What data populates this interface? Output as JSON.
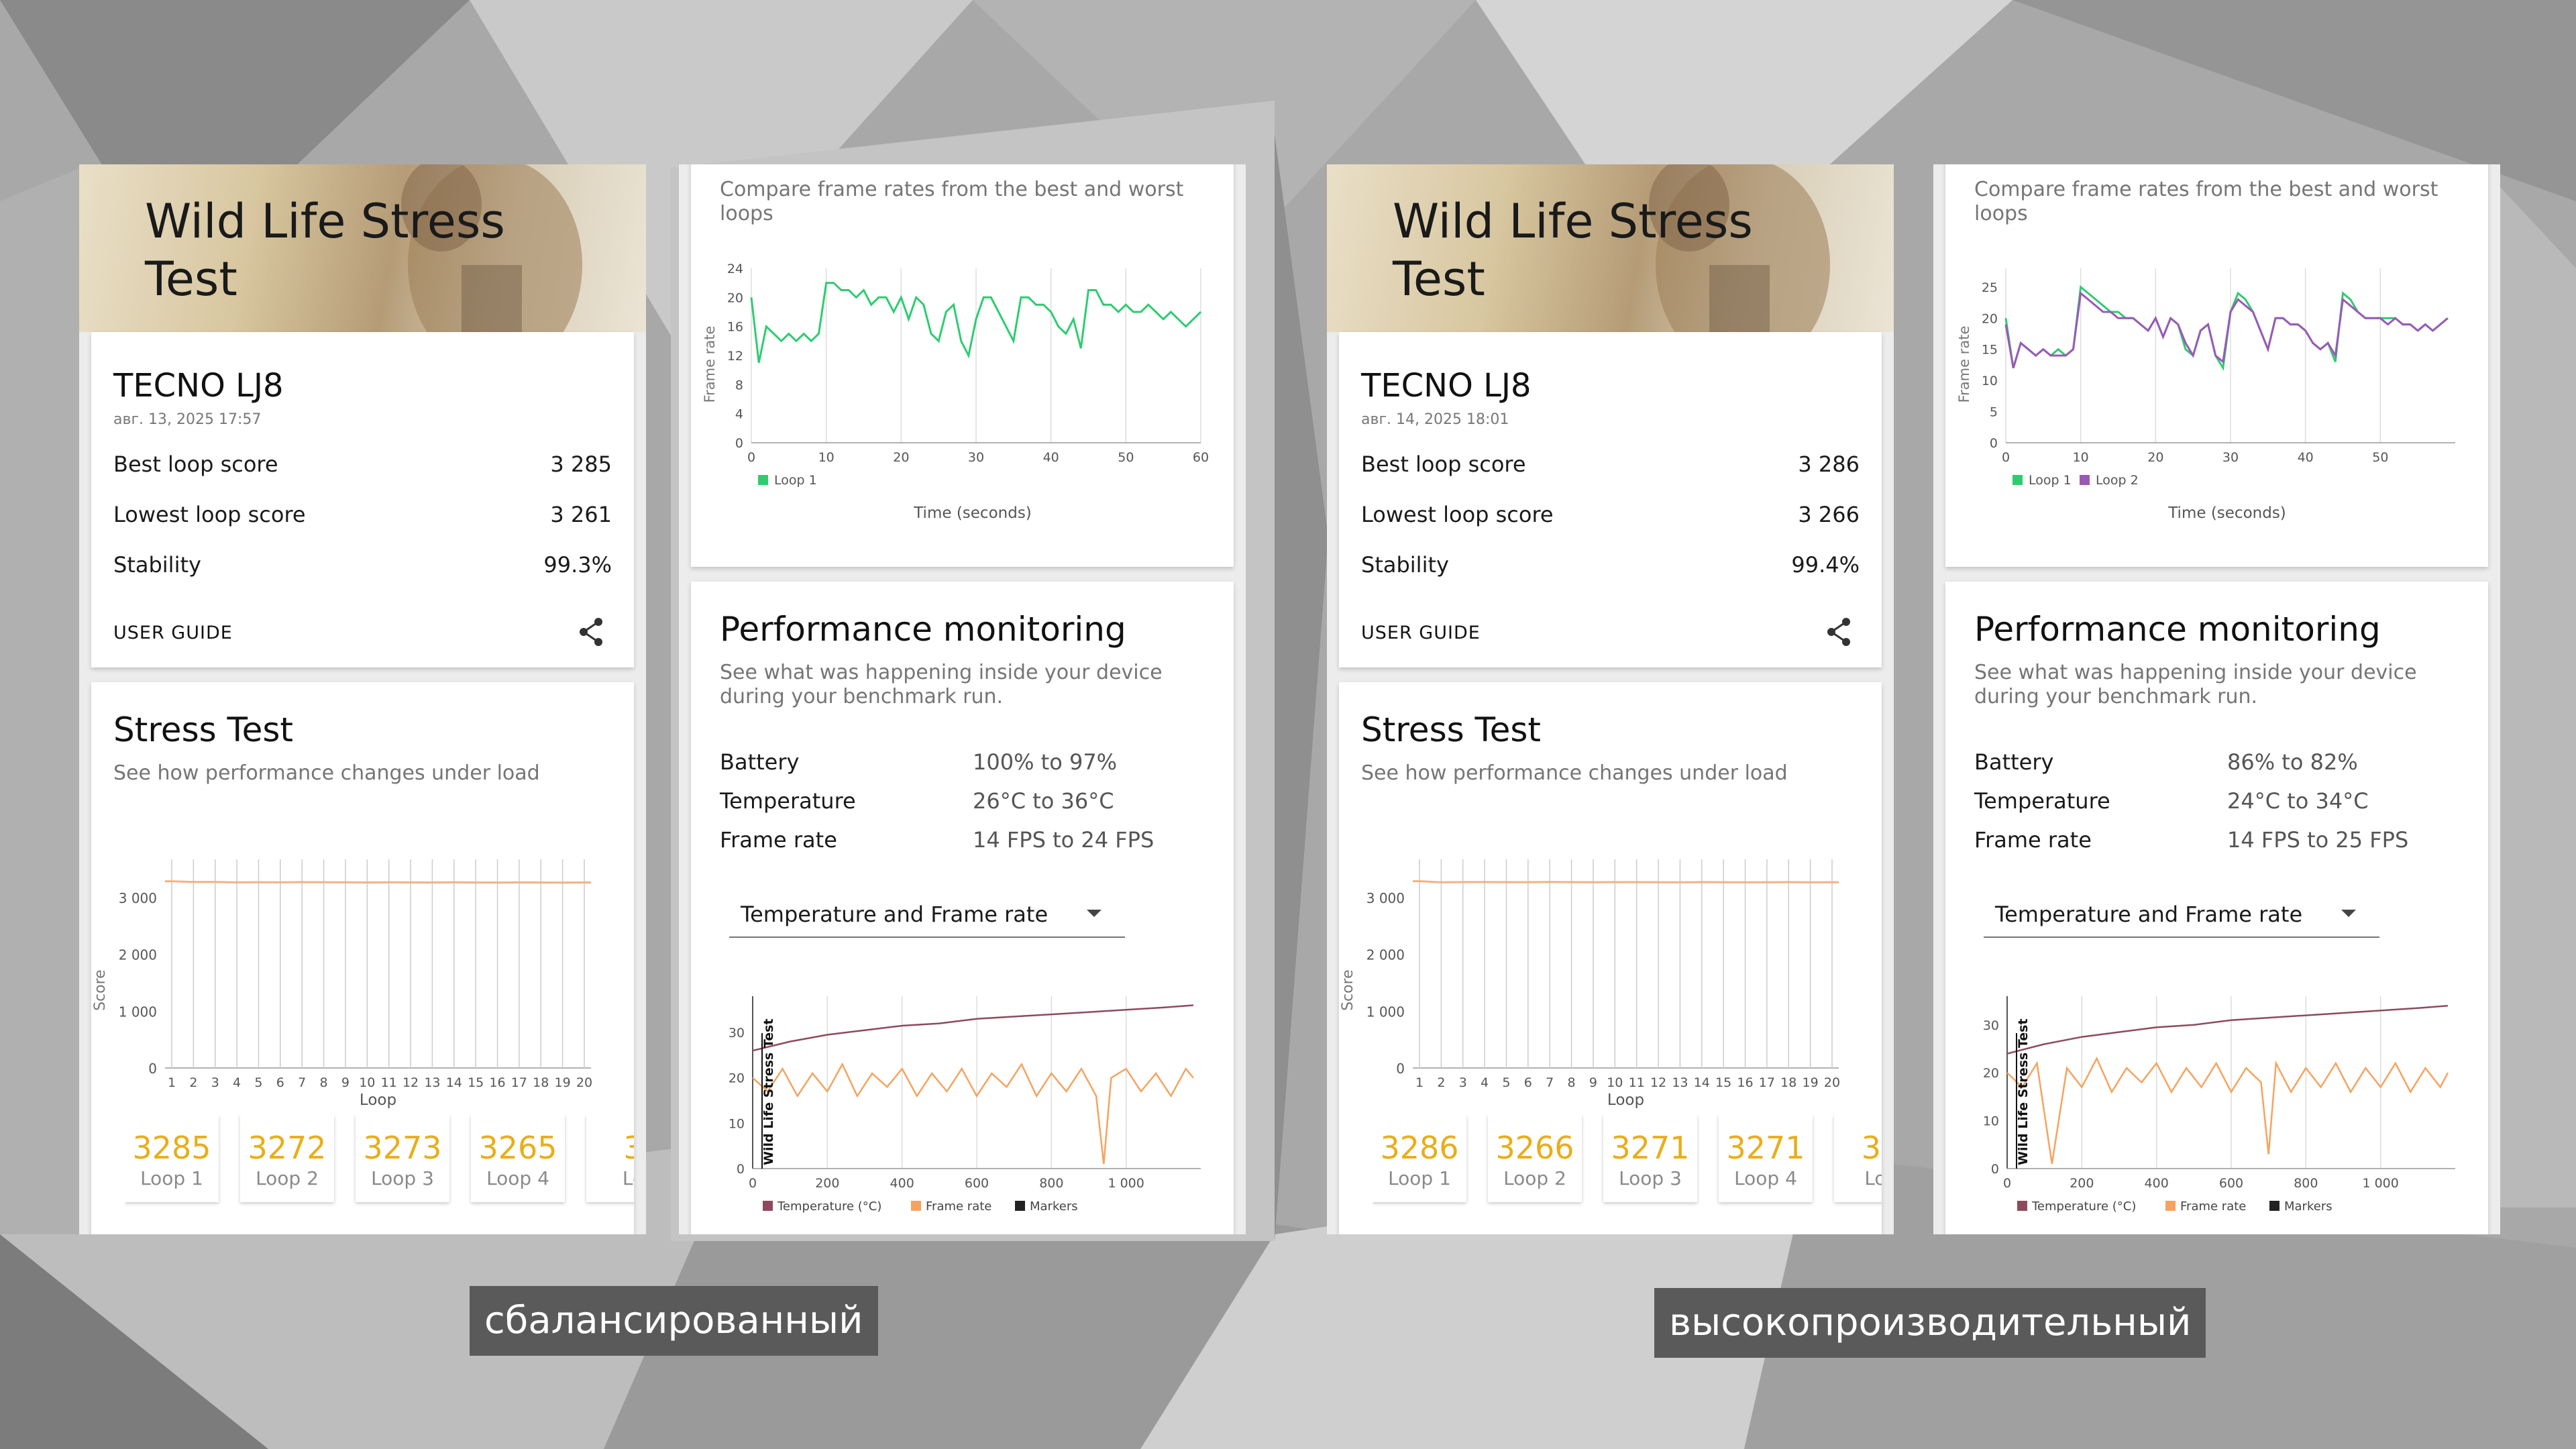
{
  "panels": [
    {
      "title_line1": "Wild Life Stress",
      "title_line2": "Test",
      "device": "TECNO LJ8",
      "date": "авг. 13, 2025 17:57",
      "best_label": "Best loop score",
      "best_value": "3 285",
      "lowest_label": "Lowest loop score",
      "lowest_value": "3 261",
      "stability_label": "Stability",
      "stability_value": "99.3%",
      "user_guide": "USER GUIDE",
      "stress_title": "Stress Test",
      "stress_sub": "See how performance changes under load",
      "loops": [
        {
          "score": "3285",
          "name": "Loop 1"
        },
        {
          "score": "3272",
          "name": "Loop 2"
        },
        {
          "score": "3273",
          "name": "Loop 3"
        },
        {
          "score": "3265",
          "name": "Loop 4"
        },
        {
          "score": "3",
          "name": "Lo"
        }
      ],
      "compare_sub": "Compare frame rates from the best and worst loops",
      "perf_title": "Performance monitoring",
      "perf_sub": "See what was happening inside your device during your benchmark run.",
      "battery_label": "Battery",
      "battery_value": "100% to 97%",
      "temp_label": "Temperature",
      "temp_value": "26°C to 36°C",
      "fps_label": "Frame rate",
      "fps_value": "14 FPS to 24 FPS",
      "dropdown": "Temperature and Frame rate"
    },
    {
      "title_line1": "Wild Life Stress",
      "title_line2": "Test",
      "device": "TECNO LJ8",
      "date": "авг. 14, 2025 18:01",
      "best_label": "Best loop score",
      "best_value": "3 286",
      "lowest_label": "Lowest loop score",
      "lowest_value": "3 266",
      "stability_label": "Stability",
      "stability_value": "99.4%",
      "user_guide": "USER GUIDE",
      "stress_title": "Stress Test",
      "stress_sub": "See how performance changes under load",
      "loops": [
        {
          "score": "3286",
          "name": "Loop 1"
        },
        {
          "score": "3266",
          "name": "Loop 2"
        },
        {
          "score": "3271",
          "name": "Loop 3"
        },
        {
          "score": "3271",
          "name": "Loop 4"
        },
        {
          "score": "32",
          "name": "Loo"
        }
      ],
      "compare_sub": "Compare frame rates from the best and worst loops",
      "perf_title": "Performance monitoring",
      "perf_sub": "See what was happening inside your device during your benchmark run.",
      "battery_label": "Battery",
      "battery_value": "86% to 82%",
      "temp_label": "Temperature",
      "temp_value": "24°C to 34°C",
      "fps_label": "Frame rate",
      "fps_value": "14 FPS to 25 FPS",
      "dropdown": "Temperature and Frame rate"
    }
  ],
  "captions": {
    "left": "сбалансированный",
    "right": "высокопроизводительный"
  },
  "chart_data": [
    {
      "id": "stress-left",
      "type": "bar",
      "ylabel": "Score",
      "xlabel": "Loop",
      "ylim": [
        0,
        3600
      ],
      "yticks": [
        "0",
        "1 000",
        "2 000",
        "3 000"
      ],
      "ytick_values": [
        0,
        1000,
        2000,
        3000
      ],
      "categories": [
        "1",
        "2",
        "3",
        "4",
        "5",
        "6",
        "7",
        "8",
        "9",
        "10",
        "11",
        "12",
        "13",
        "14",
        "15",
        "16",
        "17",
        "18",
        "19",
        "20"
      ],
      "values": [
        3285,
        3272,
        3273,
        3265,
        3268,
        3266,
        3270,
        3268,
        3266,
        3264,
        3267,
        3265,
        3263,
        3266,
        3264,
        3262,
        3265,
        3263,
        3261,
        3264
      ],
      "color": "#f4b183"
    },
    {
      "id": "stress-right",
      "type": "bar",
      "ylabel": "Score",
      "xlabel": "Loop",
      "ylim": [
        0,
        3600
      ],
      "yticks": [
        "0",
        "1 000",
        "2 000",
        "3 000"
      ],
      "ytick_values": [
        0,
        1000,
        2000,
        3000
      ],
      "categories": [
        "1",
        "2",
        "3",
        "4",
        "5",
        "6",
        "7",
        "8",
        "9",
        "10",
        "11",
        "12",
        "13",
        "14",
        "15",
        "16",
        "17",
        "18",
        "19",
        "20"
      ],
      "values": [
        3286,
        3266,
        3271,
        3271,
        3270,
        3268,
        3272,
        3270,
        3268,
        3269,
        3270,
        3268,
        3267,
        3269,
        3268,
        3267,
        3268,
        3270,
        3266,
        3268
      ],
      "color": "#f4b183"
    },
    {
      "id": "fps-left",
      "type": "line",
      "ylabel": "Frame rate",
      "xlabel": "Time (seconds)",
      "xlim": [
        0,
        60
      ],
      "ylim": [
        0,
        24
      ],
      "xticks": [
        0,
        10,
        20,
        30,
        40,
        50,
        60
      ],
      "yticks": [
        0,
        4,
        8,
        12,
        16,
        20,
        24
      ],
      "series": [
        {
          "name": "Loop 1",
          "color": "#2ecc71",
          "x": [
            0,
            1,
            2,
            3,
            4,
            5,
            6,
            7,
            8,
            9,
            10,
            11,
            12,
            13,
            14,
            15,
            16,
            17,
            18,
            19,
            20,
            21,
            22,
            23,
            24,
            25,
            26,
            27,
            28,
            29,
            30,
            31,
            32,
            33,
            34,
            35,
            36,
            37,
            38,
            39,
            40,
            41,
            42,
            43,
            44,
            45,
            46,
            47,
            48,
            49,
            50,
            51,
            52,
            53,
            54,
            55,
            56,
            57,
            58,
            59,
            60
          ],
          "y": [
            20,
            11,
            16,
            15,
            14,
            15,
            14,
            15,
            14,
            15,
            22,
            22,
            21,
            21,
            20,
            21,
            19,
            20,
            20,
            18,
            20,
            17,
            20,
            19,
            15,
            14,
            18,
            19,
            14,
            12,
            17,
            20,
            20,
            18,
            16,
            14,
            20,
            20,
            19,
            19,
            18,
            16,
            15,
            17,
            13,
            21,
            21,
            19,
            19,
            18,
            19,
            18,
            18,
            19,
            18,
            17,
            18,
            17,
            16,
            17,
            18
          ]
        }
      ]
    },
    {
      "id": "fps-right",
      "type": "line",
      "ylabel": "Frame rate",
      "xlabel": "Time (seconds)",
      "xlim": [
        0,
        60
      ],
      "ylim": [
        0,
        28
      ],
      "xticks": [
        0,
        10,
        20,
        30,
        40,
        50
      ],
      "yticks": [
        0,
        5,
        10,
        15,
        20,
        25
      ],
      "series": [
        {
          "name": "Loop 1",
          "color": "#2ecc71",
          "x": [
            0,
            1,
            2,
            3,
            4,
            5,
            6,
            7,
            8,
            9,
            10,
            11,
            12,
            13,
            14,
            15,
            16,
            17,
            18,
            19,
            20,
            21,
            22,
            23,
            24,
            25,
            26,
            27,
            28,
            29,
            30,
            31,
            32,
            33,
            34,
            35,
            36,
            37,
            38,
            39,
            40,
            41,
            42,
            43,
            44,
            45,
            46,
            47,
            48,
            49,
            50,
            51,
            52,
            53,
            54,
            55,
            56,
            57,
            58,
            59
          ],
          "y": [
            20,
            12,
            16,
            15,
            14,
            15,
            14,
            15,
            14,
            15,
            25,
            24,
            23,
            22,
            21,
            21,
            20,
            20,
            19,
            18,
            20,
            17,
            20,
            19,
            15,
            14,
            18,
            19,
            14,
            12,
            21,
            24,
            23,
            21,
            18,
            15,
            20,
            20,
            19,
            19,
            18,
            16,
            15,
            16,
            13,
            24,
            23,
            21,
            20,
            20,
            20,
            20,
            20,
            19,
            19,
            18,
            19,
            18,
            19,
            20
          ]
        },
        {
          "name": "Loop 2",
          "color": "#9b59b6",
          "x": [
            0,
            1,
            2,
            3,
            4,
            5,
            6,
            7,
            8,
            9,
            10,
            11,
            12,
            13,
            14,
            15,
            16,
            17,
            18,
            19,
            20,
            21,
            22,
            23,
            24,
            25,
            26,
            27,
            28,
            29,
            30,
            31,
            32,
            33,
            34,
            35,
            36,
            37,
            38,
            39,
            40,
            41,
            42,
            43,
            44,
            45,
            46,
            47,
            48,
            49,
            50,
            51,
            52,
            53,
            54,
            55,
            56,
            57,
            58,
            59
          ],
          "y": [
            19,
            12,
            16,
            15,
            14,
            15,
            14,
            14,
            14,
            15,
            24,
            23,
            22,
            21,
            21,
            20,
            20,
            20,
            19,
            18,
            20,
            17,
            20,
            19,
            16,
            14,
            18,
            19,
            14,
            13,
            21,
            23,
            22,
            21,
            18,
            15,
            20,
            20,
            19,
            19,
            18,
            16,
            15,
            16,
            14,
            23,
            22,
            21,
            20,
            20,
            20,
            19,
            20,
            19,
            19,
            18,
            19,
            18,
            19,
            20
          ]
        }
      ]
    },
    {
      "id": "monitor-left",
      "type": "line",
      "title": "Wild Life Stress Test",
      "xlim": [
        0,
        1200
      ],
      "ylim": [
        0,
        38
      ],
      "xticks": [
        "0",
        "200",
        "400",
        "600",
        "800",
        "1 000"
      ],
      "xtick_values": [
        0,
        200,
        400,
        600,
        800,
        1000
      ],
      "yticks": [
        0,
        10,
        20,
        30
      ],
      "series": [
        {
          "name": "Temperature (°C)",
          "color": "#8e4a5d",
          "x": [
            0,
            100,
            200,
            300,
            400,
            500,
            600,
            700,
            800,
            900,
            1000,
            1100,
            1180
          ],
          "y": [
            26,
            28,
            29.5,
            30.5,
            31.5,
            32,
            33,
            33.5,
            34,
            34.5,
            35,
            35.5,
            36
          ]
        },
        {
          "name": "Frame rate",
          "color": "#f4a460",
          "x": [
            0,
            40,
            80,
            120,
            160,
            200,
            240,
            280,
            320,
            360,
            400,
            440,
            480,
            520,
            560,
            600,
            640,
            680,
            720,
            760,
            800,
            840,
            880,
            920,
            940,
            960,
            1000,
            1040,
            1080,
            1120,
            1160,
            1180
          ],
          "y": [
            20,
            17,
            22,
            16,
            21,
            17,
            23,
            16,
            21,
            18,
            22,
            16,
            21,
            17,
            22,
            16,
            21,
            18,
            23,
            16,
            21,
            17,
            22,
            16,
            1,
            20,
            22,
            17,
            21,
            16,
            22,
            20
          ]
        },
        {
          "name": "Markers",
          "color": "#222222",
          "x": [],
          "y": []
        }
      ]
    },
    {
      "id": "monitor-right",
      "type": "line",
      "title": "Wild Life Stress Test",
      "xlim": [
        0,
        1200
      ],
      "ylim": [
        0,
        36
      ],
      "xticks": [
        "0",
        "200",
        "400",
        "600",
        "800",
        "1 000"
      ],
      "xtick_values": [
        0,
        200,
        400,
        600,
        800,
        1000
      ],
      "yticks": [
        0,
        10,
        20,
        30
      ],
      "series": [
        {
          "name": "Temperature (°C)",
          "color": "#8e4a5d",
          "x": [
            0,
            100,
            200,
            300,
            400,
            500,
            600,
            700,
            800,
            900,
            1000,
            1100,
            1180
          ],
          "y": [
            24,
            26,
            27.5,
            28.5,
            29.5,
            30,
            31,
            31.5,
            32,
            32.5,
            33,
            33.5,
            34
          ]
        },
        {
          "name": "Frame rate",
          "color": "#f4a460",
          "x": [
            0,
            40,
            80,
            120,
            160,
            200,
            240,
            280,
            320,
            360,
            400,
            440,
            480,
            520,
            560,
            600,
            640,
            680,
            700,
            720,
            760,
            800,
            840,
            880,
            920,
            960,
            1000,
            1040,
            1080,
            1120,
            1160,
            1180
          ],
          "y": [
            20,
            17,
            22,
            1,
            21,
            17,
            23,
            16,
            21,
            18,
            22,
            16,
            21,
            17,
            22,
            16,
            21,
            18,
            3,
            22,
            16,
            21,
            17,
            22,
            16,
            21,
            17,
            22,
            16,
            21,
            17,
            20
          ]
        },
        {
          "name": "Markers",
          "color": "#222222",
          "x": [],
          "y": []
        }
      ]
    }
  ]
}
